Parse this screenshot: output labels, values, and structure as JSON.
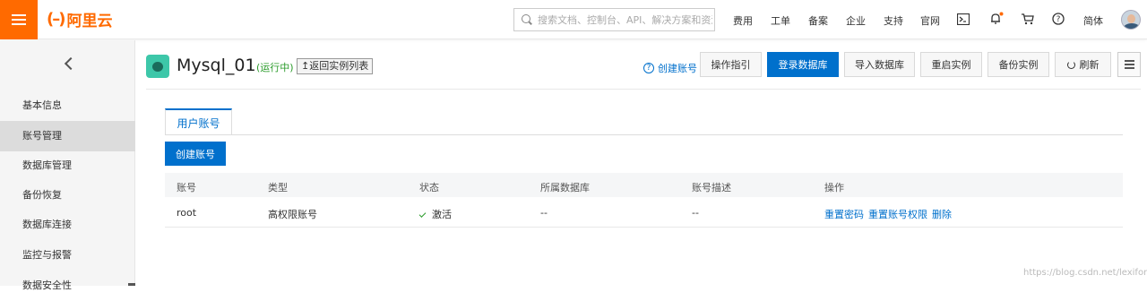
{
  "topbar": {
    "logo_text": "阿里云",
    "search_placeholder": "搜索文档、控制台、API、解决方案和资源",
    "nav": [
      "费用",
      "工单",
      "备案",
      "企业",
      "支持",
      "官网"
    ],
    "lang": "简体",
    "brand_color": "#ff6a00"
  },
  "sidebar": {
    "items": [
      "基本信息",
      "账号管理",
      "数据库管理",
      "备份恢复",
      "数据库连接",
      "监控与报警",
      "数据安全性"
    ],
    "active_item": "账号管理"
  },
  "header": {
    "instance_name": "Mysql_01",
    "status": "(运行中)",
    "back_label": "返回实例列表",
    "help_link": "创建账号",
    "buttons": [
      "操作指引",
      "登录数据库",
      "导入数据库",
      "重启实例",
      "备份实例",
      "刷新"
    ],
    "primary_color": "#0070cc"
  },
  "main": {
    "tab_label": "用户账号",
    "create_button": "创建账号",
    "table": {
      "columns": [
        "账号",
        "类型",
        "状态",
        "所属数据库",
        "账号描述",
        "操作"
      ],
      "rows": [
        {
          "account": "root",
          "type": "高权限账号",
          "status": "激活",
          "database": "--",
          "description": "--",
          "actions": [
            "重置密码",
            "重置账号权限",
            "删除"
          ]
        }
      ]
    }
  },
  "watermark": "https://blog.csdn.net/lexiforme"
}
